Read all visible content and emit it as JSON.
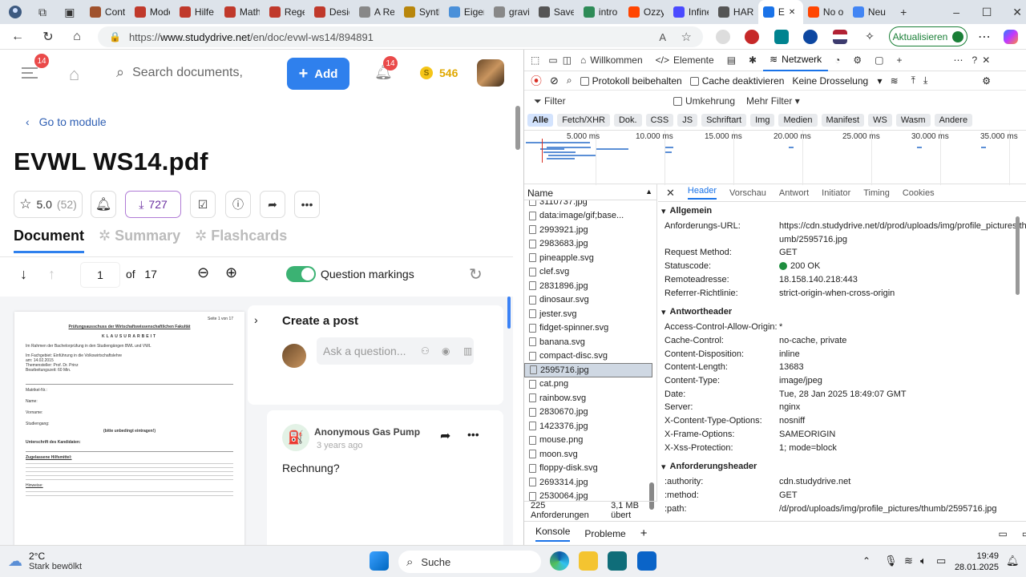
{
  "browser": {
    "tabs": [
      {
        "label": "Contr",
        "color": "#a0522d"
      },
      {
        "label": "Mode",
        "color": "#c0392b"
      },
      {
        "label": "Hilfe",
        "color": "#c0392b"
      },
      {
        "label": "Math",
        "color": "#c0392b"
      },
      {
        "label": "Rege",
        "color": "#c0392b"
      },
      {
        "label": "Desig",
        "color": "#c0392b"
      },
      {
        "label": "A Rec",
        "color": "#888888"
      },
      {
        "label": "Synth",
        "color": "#b8860b"
      },
      {
        "label": "Eigen",
        "color": "#4a90d9"
      },
      {
        "label": "gravit",
        "color": "#888888"
      },
      {
        "label": "Save",
        "color": "#555555"
      },
      {
        "label": "intro",
        "color": "#2e8b57"
      },
      {
        "label": "Ozzy",
        "color": "#ff4500"
      },
      {
        "label": "Infine",
        "color": "#4a4aff"
      },
      {
        "label": "HAR",
        "color": "#555555"
      },
      {
        "label": "E",
        "color": "#1a73e8",
        "active": true
      },
      {
        "label": "No o",
        "color": "#ff4500"
      },
      {
        "label": "Neu",
        "color": "#4285f4"
      }
    ],
    "url_prefix": "https://",
    "url_host": "www.studydrive.net",
    "url_path": "/en/doc/evwl-ws14/894891",
    "update_label": "Aktualisieren"
  },
  "page": {
    "notif_count_menu": "14",
    "search_placeholder": "Search documents,",
    "add_label": "Add",
    "notif_count_bell": "14",
    "coins": "546",
    "back_label": "Go to module",
    "title": "EVWL WS14.pdf",
    "rating": "5.0",
    "rating_count": "(52)",
    "downloads": "727",
    "tabs": {
      "document": "Document",
      "summary": "Summary",
      "flashcards": "Flashcards"
    },
    "current_page": "1",
    "of_label": "of",
    "total_pages": "17",
    "question_markings": "Question markings",
    "create_post": "Create a post",
    "ask_placeholder": "Ask a question...",
    "comment": {
      "author": "Anonymous Gas Pump",
      "time": "3 years ago",
      "text": "Rechnung?"
    },
    "pdf": {
      "page_label": "Seite 1 von 17",
      "heading": "Prüfungsausschuss der Wirtschaftswissenschaftlichen Fakultät",
      "sub": "KLAUSURARBEIT",
      "intro": "Im Rahmen der Bachelorprüfung in den Studiengängen BWL und VWL",
      "l1": "Im Fachgebiet: Einführung in die Volkswirtschaftslehre",
      "l2": "am: 14.02.2015",
      "l3": "Themensteller: Prof. Dr. Prinz",
      "l4": "Bearbeitungszeit: 60 Min.",
      "f1": "Matrikel-Nr.:",
      "f2": "Name:",
      "f3": "Vorname:",
      "f4": "Studiengang:",
      "note": "(bitte unbedingt eintragen!)",
      "sign": "Unterschrift des Kandidaten:",
      "aids": "Zugelassene Hilfsmittel:",
      "hint": "Hinweise:"
    }
  },
  "devtools": {
    "tabs": {
      "welcome": "Willkommen",
      "elements": "Elemente",
      "network": "Netzwerk"
    },
    "preserve_log": "Protokoll beibehalten",
    "disable_cache": "Cache deaktivieren",
    "throttle": "Keine Drosselung",
    "filter": "Filter",
    "invert": "Umkehrung",
    "more_filters": "Mehr Filter",
    "filter_types": [
      "Alle",
      "Fetch/XHR",
      "Dok.",
      "CSS",
      "JS",
      "Schriftart",
      "Img",
      "Medien",
      "Manifest",
      "WS",
      "Wasm",
      "Andere"
    ],
    "timeline_ticks": [
      "5.000 ms",
      "10.000 ms",
      "15.000 ms",
      "20.000 ms",
      "25.000 ms",
      "30.000 ms",
      "35.000 ms"
    ],
    "name_header": "Name",
    "requests": [
      "3110737.jpg",
      "data:image/gif;base...",
      "2993921.jpg",
      "2983683.jpg",
      "pineapple.svg",
      "clef.svg",
      "2831896.jpg",
      "dinosaur.svg",
      "jester.svg",
      "fidget-spinner.svg",
      "banana.svg",
      "compact-disc.svg",
      "2595716.jpg",
      "cat.png",
      "rainbow.svg",
      "2830670.jpg",
      "1423376.jpg",
      "mouse.png",
      "moon.svg",
      "floppy-disk.svg",
      "2693314.jpg",
      "2530064.jpg"
    ],
    "selected_index": 12,
    "status_requests": "225 Anforderungen",
    "status_size": "3,1 MB übert",
    "detail_tabs": [
      "Header",
      "Vorschau",
      "Antwort",
      "Initiator",
      "Timing",
      "Cookies"
    ],
    "general_title": "Allgemein",
    "general": [
      {
        "k": "Anforderungs-URL:",
        "v": "https://cdn.studydrive.net/d/prod/uploads/img/profile_pictures/th"
      },
      {
        "k": "",
        "v": "umb/2595716.jpg"
      },
      {
        "k": "Request Method:",
        "v": "GET"
      },
      {
        "k": "Statuscode:",
        "v": "200 OK"
      },
      {
        "k": "Remoteadresse:",
        "v": "18.158.140.218:443"
      },
      {
        "k": "Referrer-Richtlinie:",
        "v": "strict-origin-when-cross-origin"
      }
    ],
    "response_title": "Antwortheader",
    "response": [
      {
        "k": "Access-Control-Allow-Origin:",
        "v": "*"
      },
      {
        "k": "Cache-Control:",
        "v": "no-cache, private"
      },
      {
        "k": "Content-Disposition:",
        "v": "inline"
      },
      {
        "k": "Content-Length:",
        "v": "13683"
      },
      {
        "k": "Content-Type:",
        "v": "image/jpeg"
      },
      {
        "k": "Date:",
        "v": "Tue, 28 Jan 2025 18:49:07 GMT"
      },
      {
        "k": "Server:",
        "v": "nginx"
      },
      {
        "k": "X-Content-Type-Options:",
        "v": "nosniff"
      },
      {
        "k": "X-Frame-Options:",
        "v": "SAMEORIGIN"
      },
      {
        "k": "X-Xss-Protection:",
        "v": "1; mode=block"
      }
    ],
    "request_title": "Anforderungsheader",
    "request": [
      {
        "k": ":authority:",
        "v": "cdn.studydrive.net"
      },
      {
        "k": ":method:",
        "v": "GET"
      },
      {
        "k": ":path:",
        "v": "/d/prod/uploads/img/profile_pictures/thumb/2595716.jpg"
      }
    ],
    "drawer_console": "Konsole",
    "drawer_problems": "Probleme"
  },
  "taskbar": {
    "temp": "2°C",
    "weather": "Stark bewölkt",
    "search": "Suche",
    "time": "19:49",
    "date": "28.01.2025"
  },
  "colors": {
    "accent": "#2f80ed",
    "toggle": "#3bb273",
    "badge": "#ea4a4a",
    "status_ok": "#1e8e3e"
  }
}
